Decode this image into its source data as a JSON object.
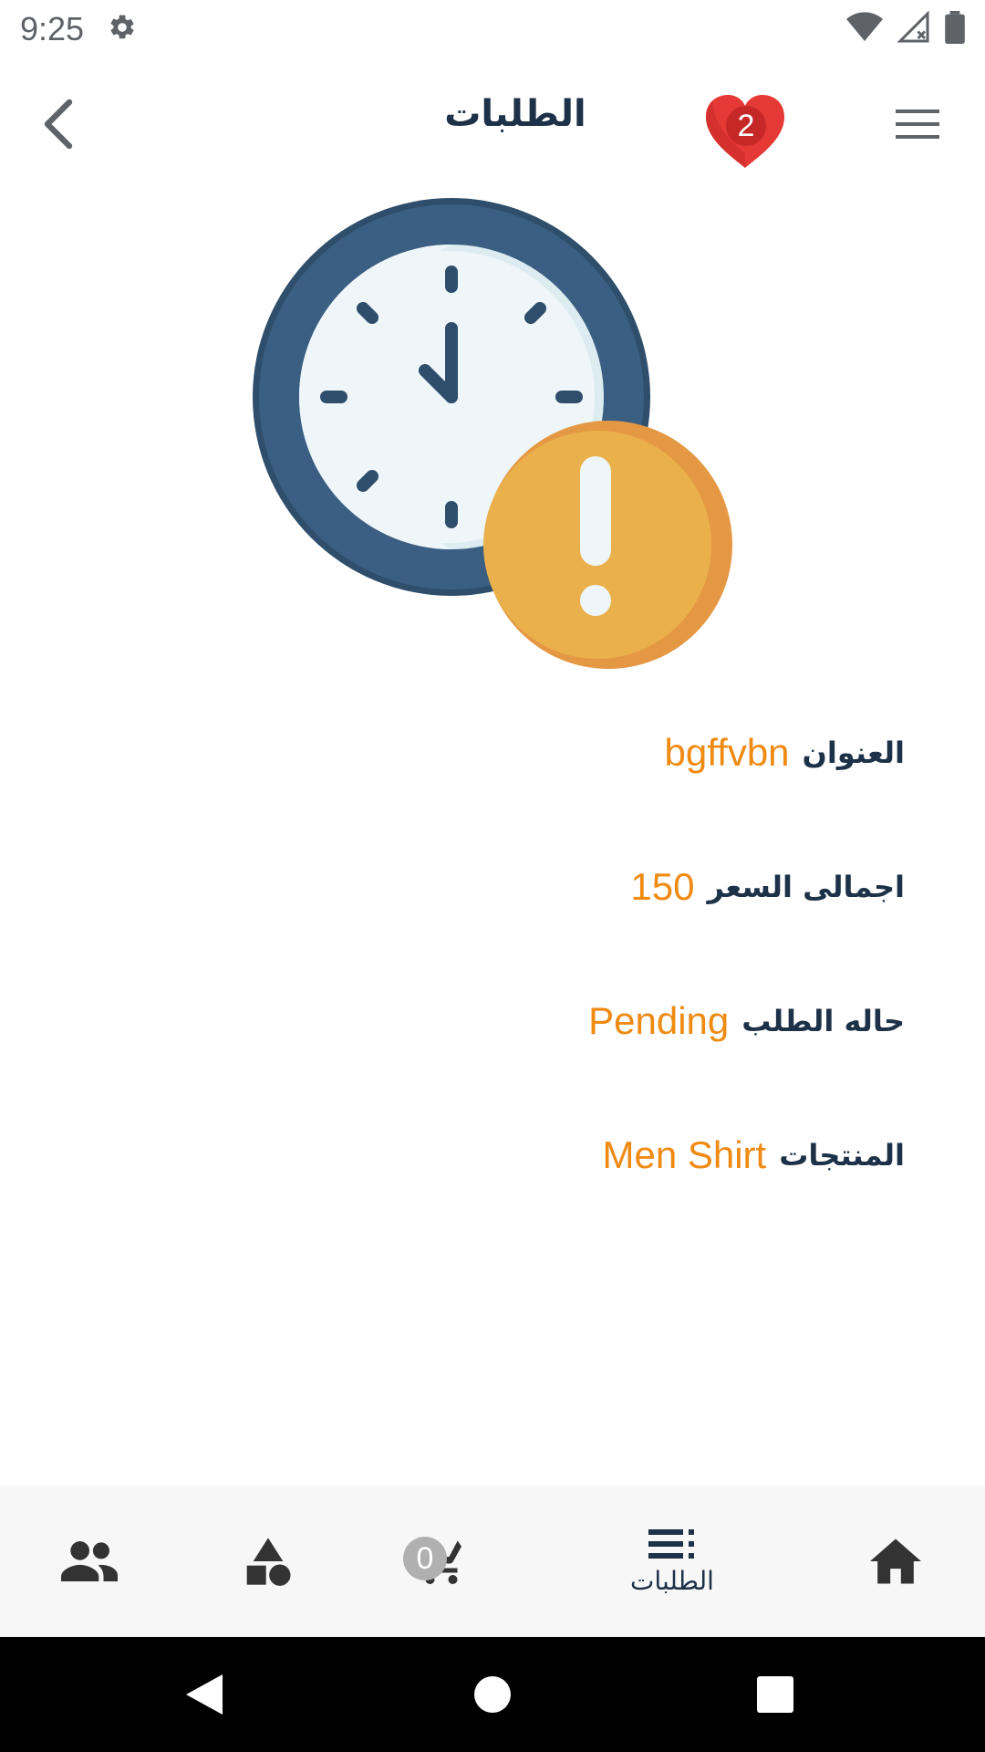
{
  "status_bar": {
    "time": "9:25",
    "icons": [
      "gear-icon",
      "wifi-icon",
      "signal-icon",
      "battery-icon"
    ]
  },
  "header": {
    "title": "الطلبات",
    "favorites_count": "2",
    "icons": [
      "back-arrow-icon",
      "heart-icon",
      "hamburger-menu-icon"
    ]
  },
  "illustration": {
    "icon": "clock-warning-illustration"
  },
  "order": {
    "rows": [
      {
        "label": "العنوان",
        "value": "bgffvbn"
      },
      {
        "label": "اجمالى السعر",
        "value": "150"
      },
      {
        "label": "حاله الطلب",
        "value": "Pending"
      },
      {
        "label": "المنتجات",
        "value": "Men Shirt"
      }
    ]
  },
  "bottom_nav": {
    "items": [
      {
        "icon": "people-icon"
      },
      {
        "icon": "categories-shapes-icon"
      },
      {
        "icon": "cart-icon",
        "badge": "0"
      },
      {
        "icon": "orders-list-icon",
        "label": "الطلبات",
        "active": true
      },
      {
        "icon": "home-icon"
      }
    ]
  },
  "system_nav": {
    "icons": [
      "back-triangle-icon",
      "home-circle-icon",
      "recents-square-icon"
    ]
  },
  "colors": {
    "primary_text": "#1d3148",
    "accent_orange": "#ef8a12",
    "heart_red": "#e53935",
    "nav_background": "#f7f7f7"
  }
}
